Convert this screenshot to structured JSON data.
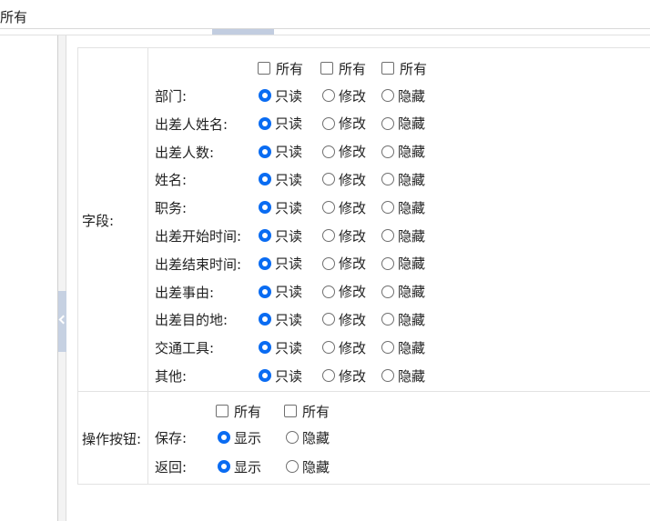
{
  "top": {
    "label": "所有"
  },
  "fields_section": {
    "label": "字段:",
    "all_headers": [
      "所有",
      "所有",
      "所有"
    ],
    "option_labels": [
      "只读",
      "修改",
      "隐藏"
    ],
    "rows": [
      {
        "label": "部门:",
        "selected": 0
      },
      {
        "label": "出差人姓名:",
        "selected": 0
      },
      {
        "label": "出差人数:",
        "selected": 0
      },
      {
        "label": "姓名:",
        "selected": 0
      },
      {
        "label": "职务:",
        "selected": 0
      },
      {
        "label": "出差开始时间:",
        "selected": 0
      },
      {
        "label": "出差结束时间:",
        "selected": 0
      },
      {
        "label": "出差事由:",
        "selected": 0
      },
      {
        "label": "出差目的地:",
        "selected": 0
      },
      {
        "label": "交通工具:",
        "selected": 0
      },
      {
        "label": "其他:",
        "selected": 0
      }
    ]
  },
  "buttons_section": {
    "label": "操作按钮:",
    "all_headers": [
      "所有",
      "所有"
    ],
    "option_labels": [
      "显示",
      "隐藏"
    ],
    "rows": [
      {
        "label": "保存:",
        "selected": 0
      },
      {
        "label": "返回:",
        "selected": 0
      }
    ]
  },
  "colors": {
    "accent": "#0a6cf2",
    "splitter": "#c2cde0"
  },
  "icons": {
    "collapse": "chevron-left-icon"
  }
}
